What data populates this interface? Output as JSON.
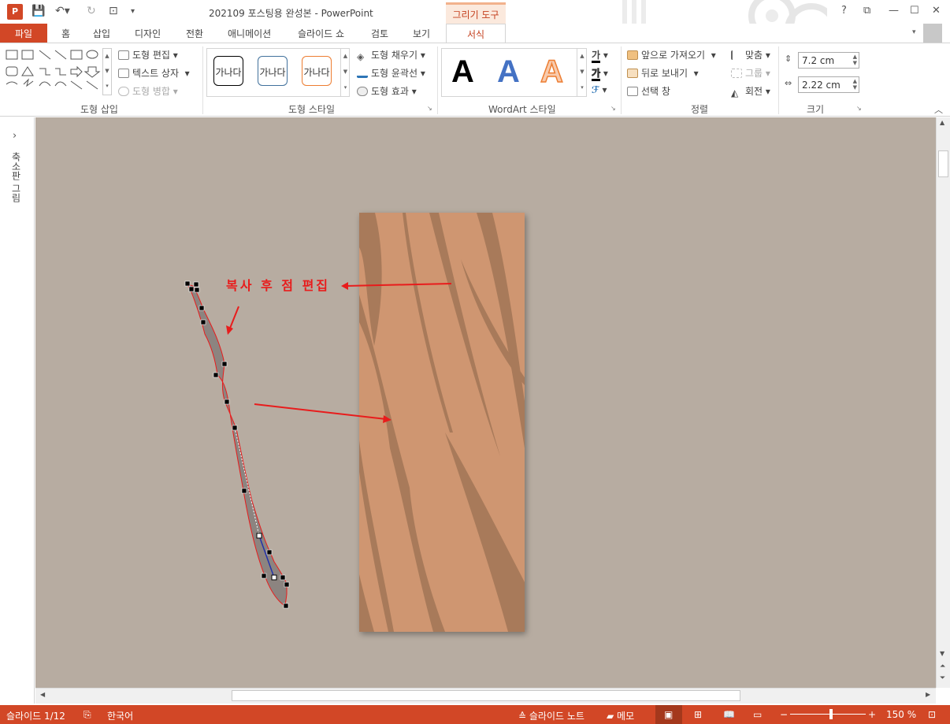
{
  "title": "202109 포스팅용 완성본 - PowerPoint",
  "context_tab": "그리기 도구",
  "tabs": {
    "file": "파일",
    "home": "홈",
    "insert": "삽입",
    "design": "디자인",
    "transitions": "전환",
    "animations": "애니메이션",
    "slideshow": "슬라이드 쇼",
    "review": "검토",
    "view": "보기",
    "format": "서식"
  },
  "ribbon": {
    "insert_shapes": {
      "label": "도형 삽입",
      "edit_shape": "도형 편집",
      "text_box": "텍스트 상자",
      "merge_shapes": "도형 병합"
    },
    "shape_styles": {
      "label": "도형 스타일",
      "sample": "가나다",
      "fill": "도형 채우기",
      "outline": "도형 윤곽선",
      "effects": "도형 효과"
    },
    "wordart": {
      "label": "WordArt 스타일",
      "letter": "A",
      "text_fill": "가",
      "text_outline": "가"
    },
    "arrange": {
      "label": "정렬",
      "bring_forward": "앞으로 가져오기",
      "send_backward": "뒤로 보내기",
      "selection_pane": "선택 창",
      "align": "맞춤",
      "group": "그룹",
      "rotate": "회전"
    },
    "size": {
      "label": "크기",
      "height": "7.2 cm",
      "width": "2.22 cm"
    }
  },
  "thumbnail_panel_label": "축소판 그림",
  "annotation": "복사 후 점 편집",
  "status": {
    "slide": "슬라이드 1/12",
    "language": "한국어",
    "notes": "슬라이드 노트",
    "comments": "메모",
    "zoom": "150 %"
  },
  "colors": {
    "accent": "#d24726",
    "canvas": "#b7aca1",
    "wood": "#cf9671",
    "wood_dark": "#a87a5a",
    "annotation": "#e81c1c"
  }
}
